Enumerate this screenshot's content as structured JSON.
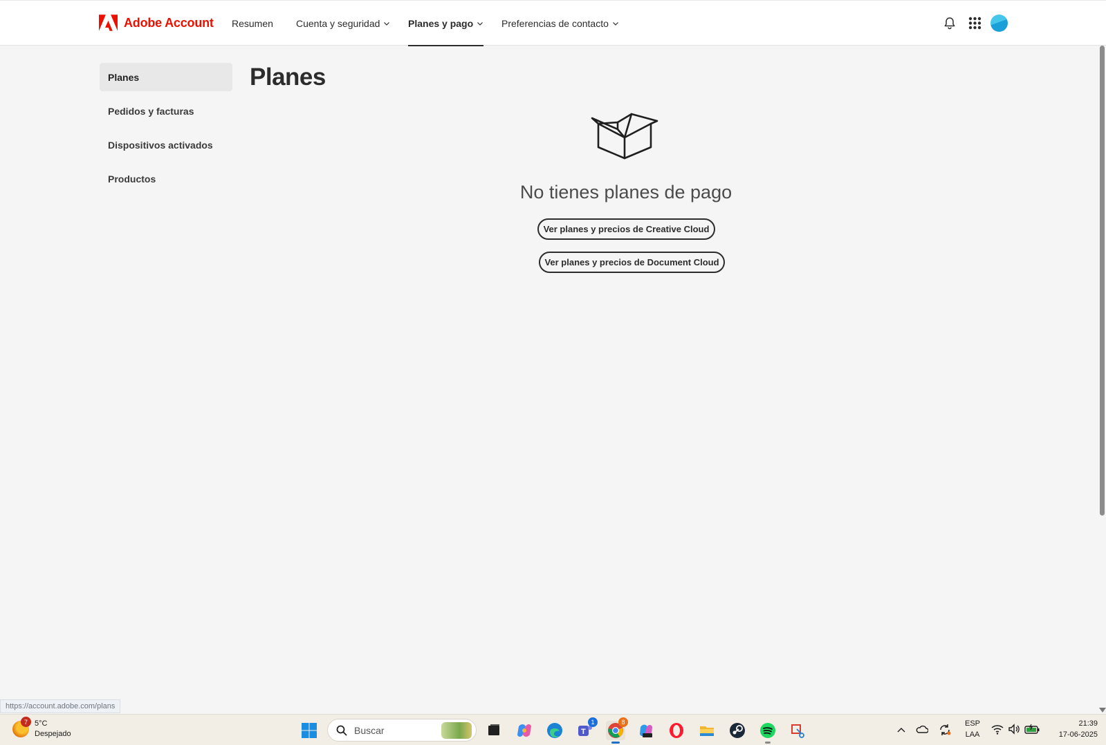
{
  "brand": {
    "name": "Adobe Account",
    "color": "#eb1000"
  },
  "nav": {
    "items": [
      {
        "label": "Resumen"
      },
      {
        "label": "Cuenta y seguridad"
      },
      {
        "label": "Planes y pago"
      },
      {
        "label": "Preferencias de contacto"
      }
    ],
    "active_index": 2
  },
  "header_icons": [
    "bell-icon",
    "apps-grid-icon",
    "avatar"
  ],
  "sidebar": {
    "items": [
      {
        "label": "Planes"
      },
      {
        "label": "Pedidos y facturas"
      },
      {
        "label": "Dispositivos activados"
      },
      {
        "label": "Productos"
      }
    ],
    "active_index": 0
  },
  "main": {
    "title": "Planes",
    "empty_state": {
      "icon": "open-box-icon",
      "message": "No tienes planes de pago",
      "buttons": [
        {
          "label": "Ver planes y precios de Creative Cloud"
        },
        {
          "label": "Ver planes y precios de Document Cloud"
        }
      ]
    }
  },
  "status_bar": {
    "url": "https://account.adobe.com/plans"
  },
  "taskbar": {
    "weather": {
      "temp": "5°C",
      "condition": "Despejado",
      "badge": "7"
    },
    "search_placeholder": "Buscar",
    "apps": [
      "start-icon",
      "search-icon",
      "task-view-icon",
      "copilot-icon",
      "edge-icon",
      "teams-icon",
      "chrome-icon",
      "m365-copilot-icon",
      "opera-icon",
      "file-explorer-icon",
      "steam-icon",
      "spotify-icon",
      "snipping-tool-icon"
    ],
    "teams_badge": "1",
    "chrome_badge": "8",
    "tray": {
      "language_top": "ESP",
      "language_bottom": "LAA",
      "time": "21:39",
      "date": "17-06-2025"
    }
  }
}
